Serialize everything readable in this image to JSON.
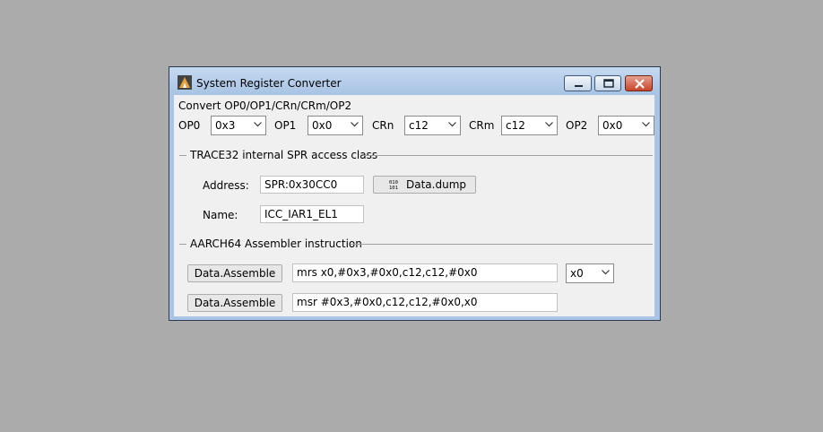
{
  "window": {
    "title": "System Register Converter"
  },
  "convert": {
    "heading": "Convert OP0/OP1/CRn/CRm/OP2",
    "op0": {
      "label": "OP0",
      "value": "0x3"
    },
    "op1": {
      "label": "OP1",
      "value": "0x0"
    },
    "crn": {
      "label": "CRn",
      "value": "c12"
    },
    "crm": {
      "label": "CRm",
      "value": "c12"
    },
    "op2": {
      "label": "OP2",
      "value": "0x0"
    }
  },
  "spr": {
    "group_title": "TRACE32 internal SPR access class",
    "address_label": "Address:",
    "address_value": "SPR:0x30CC0",
    "dump_button": "Data.dump",
    "name_label": "Name:",
    "name_value": "ICC_IAR1_EL1"
  },
  "asm": {
    "group_title": "AARCH64 Assembler instruction",
    "assemble_button_1": "Data.Assemble",
    "instruction_1": "mrs x0,#0x3,#0x0,c12,c12,#0x0",
    "register_value": "x0",
    "assemble_button_2": "Data.Assemble",
    "instruction_2": "msr #0x3,#0x0,c12,c12,#0x0,x0"
  }
}
